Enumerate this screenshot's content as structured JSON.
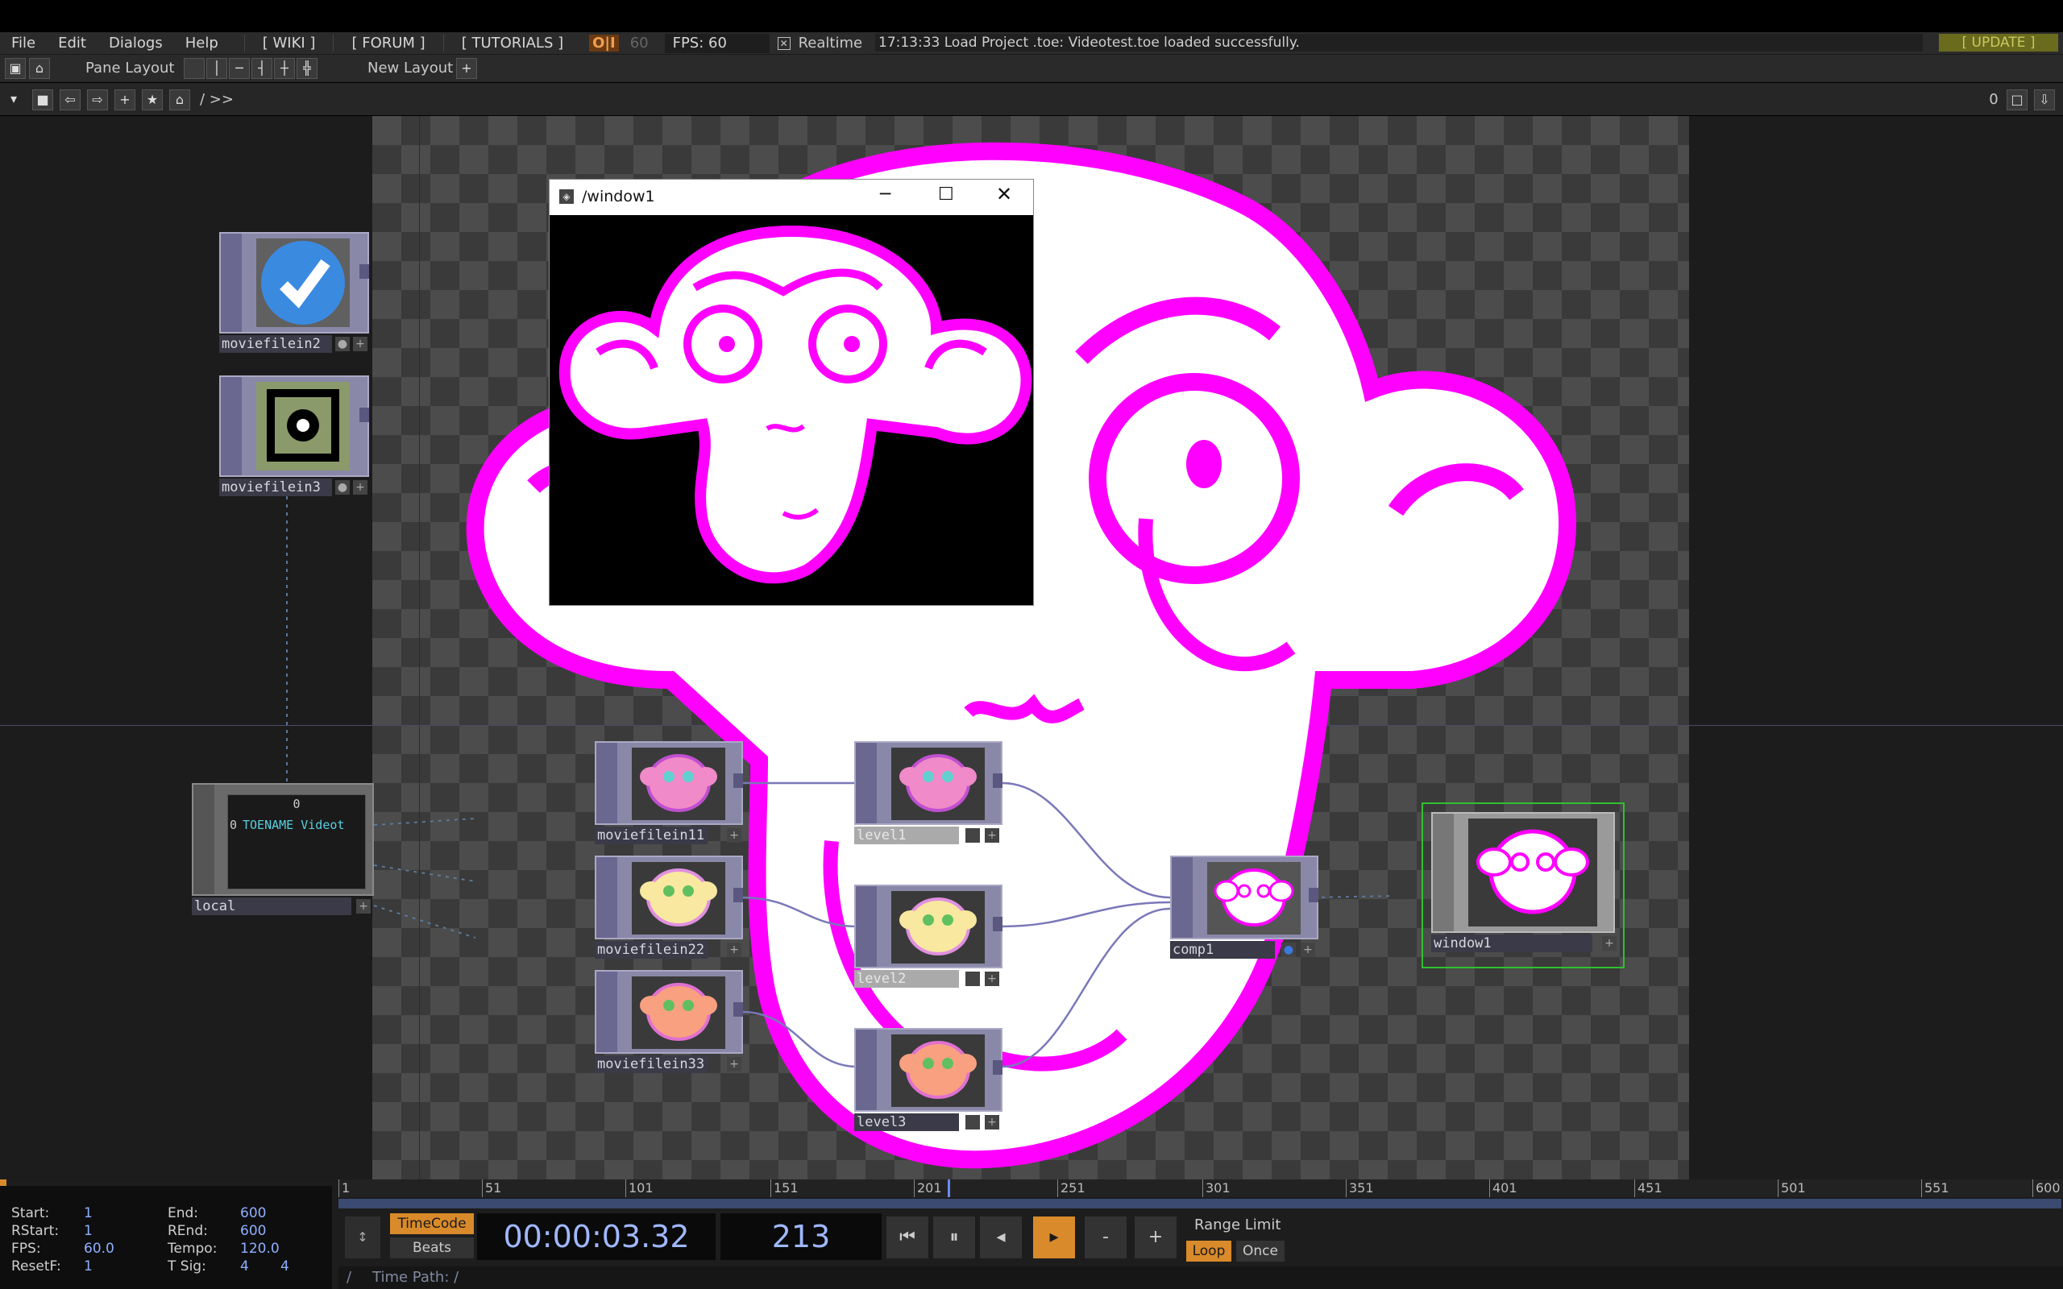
{
  "menu": {
    "items": [
      "File",
      "Edit",
      "Dialogs",
      "Help"
    ],
    "links": [
      "[ WIKI ]",
      "[ FORUM ]",
      "[ TUTORIALS ]"
    ],
    "oi": "O|I",
    "fps_dim": "60",
    "fps_label": "FPS:  60",
    "realtime_label": "Realtime",
    "status": "17:13:33 Load Project .toe: Videotest.toe loaded successfully.",
    "update": "[ UPDATE ]"
  },
  "panebar": {
    "pane_layout": "Pane Layout",
    "new_layout": "New Layout"
  },
  "pathbar": {
    "path": "/ >>",
    "right_value": "0"
  },
  "window": {
    "title": "/window1"
  },
  "nodes": {
    "moviefilein2": "moviefilein2",
    "moviefilein3": "moviefilein3",
    "local": "local",
    "local_text_top": "0",
    "local_text_row_num": "0",
    "local_text_row": "TOENAME Videot",
    "moviefilein11": "moviefilein11",
    "moviefilein22": "moviefilein22",
    "moviefilein33": "moviefilein33",
    "level1": "level1",
    "level2": "level2",
    "level3": "level3",
    "comp1": "comp1",
    "window1": "window1"
  },
  "timeline": {
    "info": {
      "start_label": "Start:",
      "start": "1",
      "end_label": "End:",
      "end": "600",
      "rstart_label": "RStart:",
      "rstart": "1",
      "rend_label": "REnd:",
      "rend": "600",
      "fps_label": "FPS:",
      "fps": "60.0",
      "tempo_label": "Tempo:",
      "tempo": "120.0",
      "resetf_label": "ResetF:",
      "resetf": "1",
      "tsig_label": "T Sig:",
      "tsig_a": "4",
      "tsig_b": "4"
    },
    "ruler_ticks": [
      "1",
      "51",
      "101",
      "151",
      "201",
      "251",
      "301",
      "351",
      "401",
      "451",
      "501",
      "551",
      "600"
    ],
    "timecode_btn": "TimeCode",
    "beats_btn": "Beats",
    "timecode": "00:00:03.32",
    "frame": "213",
    "range_limit": "Range Limit",
    "loop": "Loop",
    "once": "Once",
    "time_path_slash": "/",
    "time_path": "Time Path: /"
  },
  "colors": {
    "magenta": "#ff00ff",
    "node_purple": "#8a88a8",
    "accent_orange": "#d98a2a",
    "timecode_blue": "#9fb8ff"
  }
}
